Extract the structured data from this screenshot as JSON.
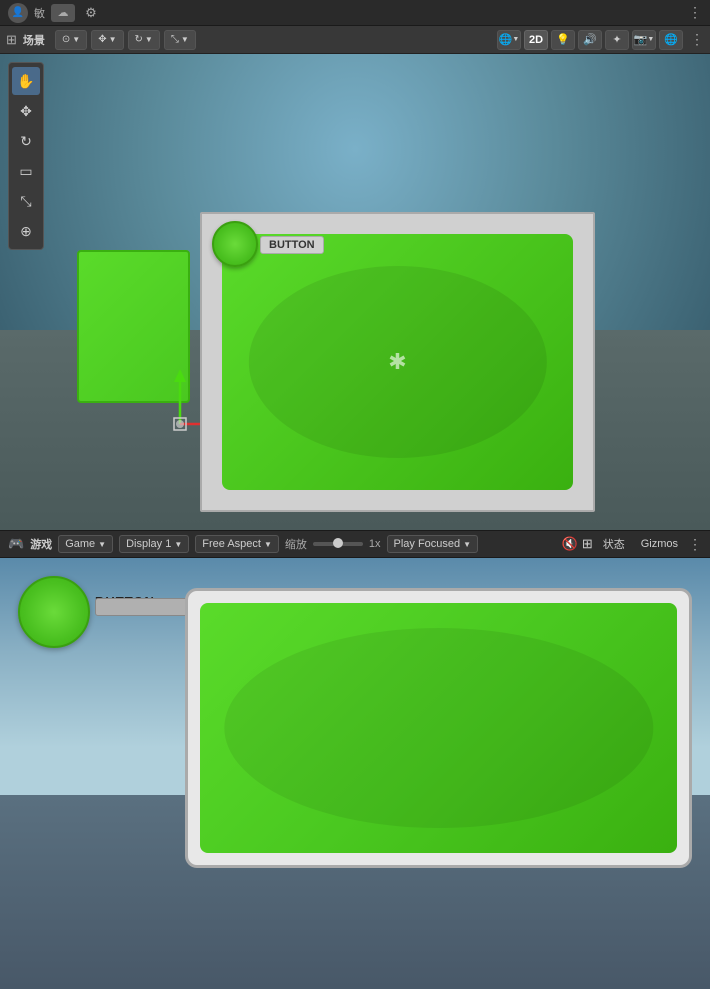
{
  "topbar": {
    "user_icon": "👤",
    "cloud_icon": "☁",
    "settings_icon": "⚙",
    "menu_dots": "⋮"
  },
  "scene_toolbar": {
    "label": "场景",
    "grid_icon": "⊞",
    "view_dropdown": "⊙",
    "move_icon": "✥",
    "rotate_icon": "↻",
    "scale_icon": "⤡",
    "view2d": "2D",
    "light_icon": "💡",
    "audio_icon": "🔊",
    "fx_icon": "✦",
    "camera_icon": "📷",
    "globe_icon": "🌐"
  },
  "game_toolbar": {
    "label": "游戏",
    "game_dropdown": "Game",
    "game_dropdown_chevron": "▼",
    "display_label": "Display 1",
    "display_chevron": "▼",
    "aspect_label": "Free Aspect",
    "aspect_chevron": "▼",
    "zoom_prefix": "缩放",
    "zoom_value": "1x",
    "play_focused_label": "Play Focused",
    "play_focused_chevron": "▼",
    "mute_icon": "🔇",
    "grid_icon": "⊞",
    "status_label": "状态",
    "gizmos_label": "Gizmos",
    "dots": "⋮"
  },
  "ui_elements": {
    "button_label": "BUTTON",
    "game_button_label": "BUTTON"
  }
}
